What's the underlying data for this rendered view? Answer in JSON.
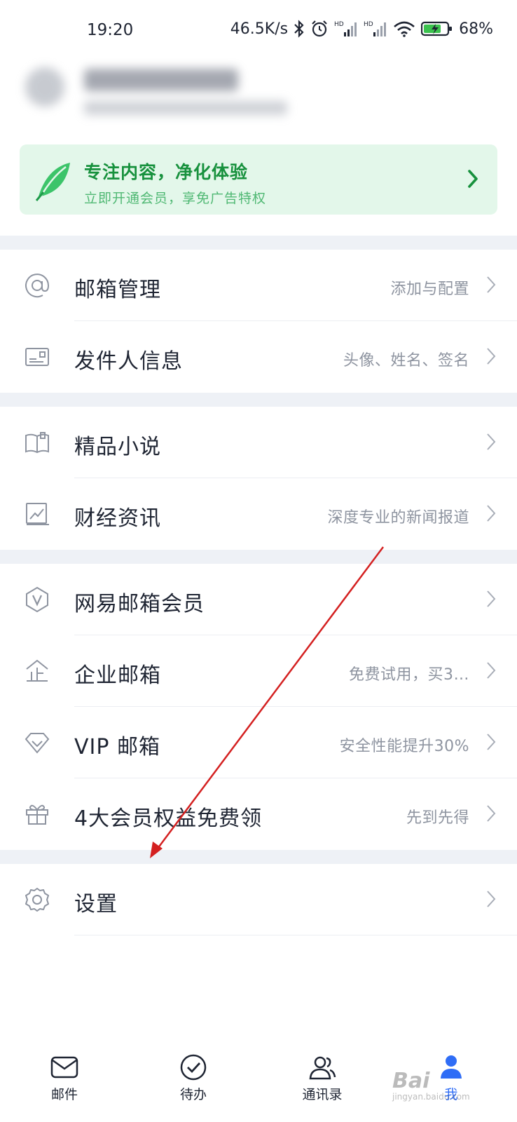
{
  "status_bar": {
    "time": "19:20",
    "speed": "46.5K/s",
    "battery": "68%",
    "icons": [
      "bluetooth-icon",
      "alarm-icon",
      "signal-icon",
      "signal-icon",
      "wifi-icon",
      "battery-icon"
    ]
  },
  "promo": {
    "title": "专注内容，净化体验",
    "subtitle": "立即开通会员，享免广告特权",
    "icon": "leaf-icon",
    "accent": "#17913d",
    "background": "#e3f7ea"
  },
  "menu": {
    "mailbox_manage": {
      "label": "邮箱管理",
      "hint": "添加与配置",
      "icon": "at-sign-icon"
    },
    "sender_info": {
      "label": "发件人信息",
      "hint": "头像、姓名、签名",
      "icon": "id-card-icon"
    },
    "novels": {
      "label": "精品小说",
      "hint": "",
      "icon": "book-icon"
    },
    "finance": {
      "label": "财经资讯",
      "hint": "深度专业的新闻报道",
      "icon": "chart-icon"
    },
    "member": {
      "label": "网易邮箱会员",
      "hint": "",
      "icon": "vip-badge-icon"
    },
    "enterprise": {
      "label": "企业邮箱",
      "hint": "免费试用，买3…",
      "icon": "enterprise-icon"
    },
    "vip_mail": {
      "label": "VIP 邮箱",
      "hint": "安全性能提升30%",
      "icon": "diamond-icon"
    },
    "benefits": {
      "label": "4大会员权益免费领",
      "hint": "先到先得",
      "icon": "gift-icon"
    },
    "settings": {
      "label": "设置",
      "hint": "",
      "icon": "gear-icon"
    }
  },
  "tabbar": {
    "mail": {
      "label": "邮件",
      "icon": "mail-icon"
    },
    "todo": {
      "label": "待办",
      "icon": "check-circle-icon"
    },
    "contacts": {
      "label": "通讯录",
      "icon": "contacts-icon"
    },
    "me": {
      "label": "我",
      "icon": "person-icon",
      "active": true,
      "color": "#2f6df6"
    }
  },
  "watermark": {
    "text": "Bai",
    "sub": "jingyan.baidu.com"
  }
}
